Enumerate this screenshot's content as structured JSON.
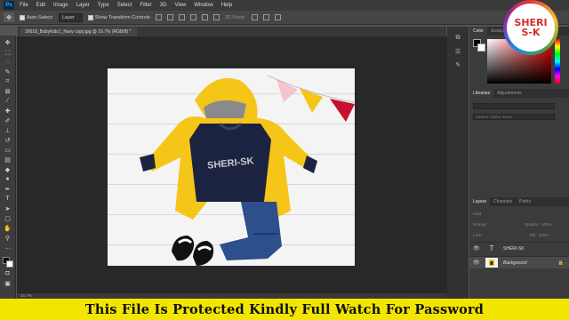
{
  "menubar": {
    "logo": "Ps",
    "items": [
      "File",
      "Edit",
      "Image",
      "Layer",
      "Type",
      "Select",
      "Filter",
      "3D",
      "View",
      "Window",
      "Help"
    ]
  },
  "optionsbar": {
    "auto_select_label": "Auto-Select:",
    "auto_select_value": "Layer",
    "show_transform_label": "Show Transform Controls",
    "mode_label": "3D Mode:"
  },
  "document": {
    "tab_title": "30018_BabyKids1_Navy copy.jpg @ 16.7% (RGB/8) *",
    "shirt_text": "SHERI-SK",
    "zoom_status": "16.7%"
  },
  "panels": {
    "color_tabs": [
      "Color",
      "Swatches"
    ],
    "libraries_tabs": [
      "Libraries",
      "Adjustments"
    ],
    "libraries_search_placeholder": "Search Adobe Stock",
    "layers_tabs": [
      "Layers",
      "Channels",
      "Paths"
    ],
    "filter_kind": "Kind",
    "blend_mode": "Normal",
    "opacity_label": "Opacity:",
    "opacity_value": "100%",
    "lock_label": "Lock:",
    "fill_label": "Fill:",
    "fill_value": "100%",
    "layers": [
      {
        "name": "SHERI-SK",
        "type": "text"
      },
      {
        "name": "Background",
        "type": "image"
      }
    ]
  },
  "watermark": {
    "line1": "SHERI",
    "line2": "S-K"
  },
  "banner": {
    "text": "This File Is Protected Kindly Full Watch For Password",
    "bg_color": "#f2e600"
  },
  "colors": {
    "accent": "#31a8ff",
    "canvas_bg": "#282828",
    "jacket": "#f5c518",
    "shirt": "#1c2340"
  }
}
